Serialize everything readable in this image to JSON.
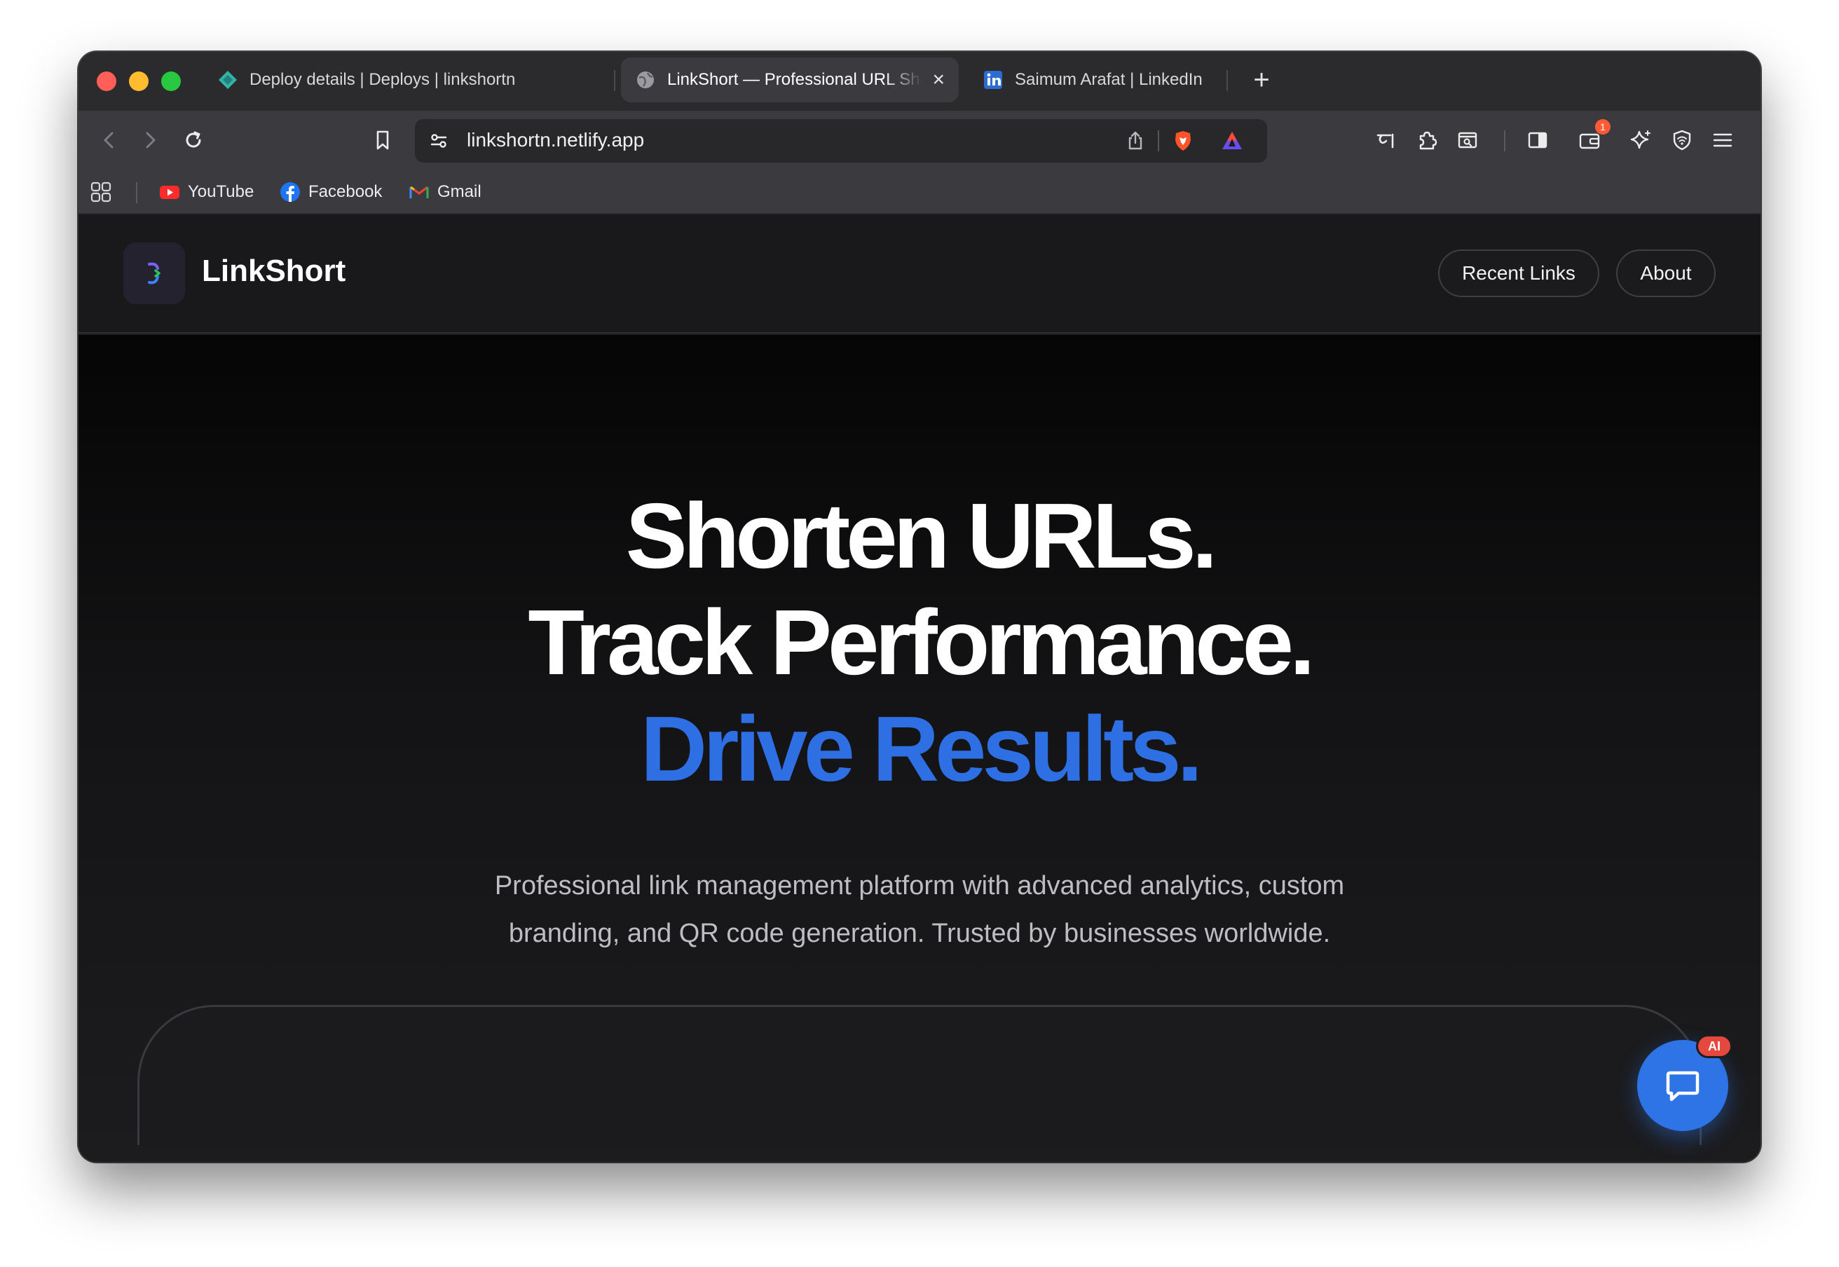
{
  "browser": {
    "tabs": [
      {
        "title": "Deploy details | Deploys | linkshortn",
        "icon": "netlify-icon",
        "active": false
      },
      {
        "title": "LinkShort — Professional URL Shortener",
        "icon": "globe-icon",
        "active": true
      },
      {
        "title": "Saimum Arafat | LinkedIn",
        "icon": "linkedin-icon",
        "active": false
      }
    ],
    "new_tab_label": "+",
    "close_tab_label": "×",
    "url": "linkshortn.netlify.app",
    "wallet_badge": "1",
    "bookmarks": [
      {
        "label": "YouTube",
        "icon": "youtube-icon"
      },
      {
        "label": "Facebook",
        "icon": "facebook-icon"
      },
      {
        "label": "Gmail",
        "icon": "gmail-icon"
      }
    ]
  },
  "site": {
    "brand": "LinkShort",
    "nav": {
      "recent_links": "Recent Links",
      "about": "About"
    },
    "hero": {
      "line1": "Shorten URLs.",
      "line2": "Track Performance.",
      "line3": "Drive Results.",
      "subtitle": "Professional link management platform with advanced analytics, custom branding, and QR code generation. Trusted by businesses worldwide."
    },
    "chat": {
      "badge": "AI"
    }
  },
  "colors": {
    "accent": "#2f6fe4",
    "background": "#1c1c1e",
    "header": "#19191b"
  }
}
